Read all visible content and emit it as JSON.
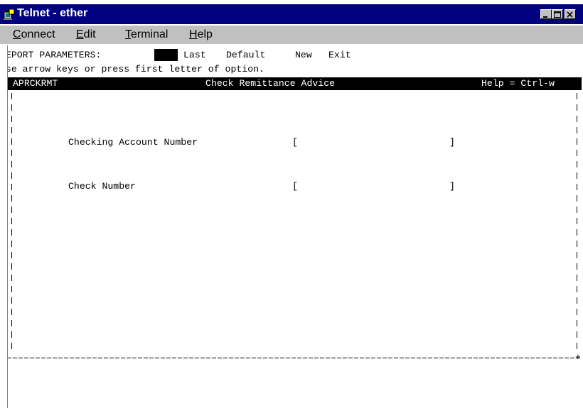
{
  "window": {
    "title": "Telnet - ether",
    "icon": "telnet-app-icon"
  },
  "menu": [
    {
      "label": "Connect",
      "accel": "C",
      "rest": "onnect"
    },
    {
      "label": "Edit",
      "accel": "E",
      "rest": "dit"
    },
    {
      "label": "Terminal",
      "accel": "T",
      "rest": "erminal"
    },
    {
      "label": "Help",
      "accel": "H",
      "rest": "elp"
    }
  ],
  "terminal": {
    "prompt_label": "REPORT PARAMETERS:",
    "options": [
      "Last",
      "Default",
      "New",
      "Exit"
    ],
    "hint": "Use arrow keys or press first letter of option.",
    "header": {
      "program": "APRCKRMT",
      "title": "Check Remittance Advice",
      "help": "Help = Ctrl-w"
    },
    "fields": [
      {
        "label": "Checking Account Number",
        "open": "[",
        "close": "]",
        "value": ""
      },
      {
        "label": "Check Number",
        "open": "[",
        "close": "]",
        "value": ""
      }
    ],
    "corner": "+"
  }
}
